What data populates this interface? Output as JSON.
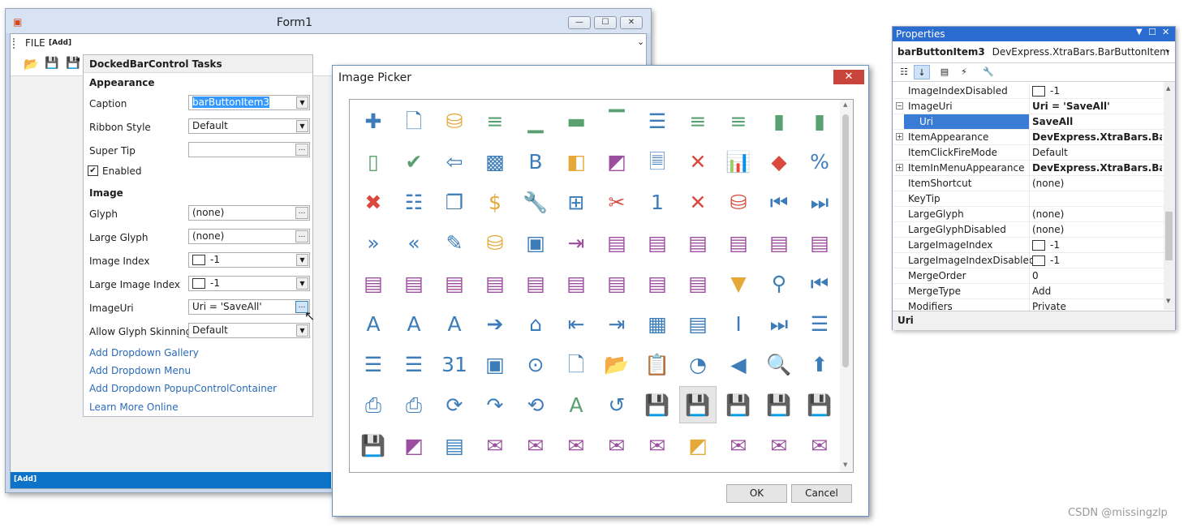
{
  "form1": {
    "title": "Form1",
    "menu": {
      "file_label": "FILE",
      "add_label": "[Add]"
    },
    "status_add": "[Add]",
    "controls": {
      "minimize": "—",
      "maximize": "☐",
      "close": "✕"
    }
  },
  "tasks": {
    "header": "DockedBarControl Tasks",
    "appearance": "Appearance",
    "caption_label": "Caption",
    "caption_value": "barButtonItem3",
    "ribbon_style_label": "Ribbon Style",
    "ribbon_style_value": "Default",
    "super_tip_label": "Super Tip",
    "super_tip_value": "",
    "enabled_label": "Enabled",
    "image": "Image",
    "glyph_label": "Glyph",
    "glyph_value": "(none)",
    "large_glyph_label": "Large Glyph",
    "large_glyph_value": "(none)",
    "image_index_label": "Image Index",
    "image_index_value": "-1",
    "large_image_index_label": "Large Image Index",
    "large_image_index_value": "-1",
    "image_uri_label": "ImageUri",
    "image_uri_value": "Uri = 'SaveAll'",
    "glyph_skinning_label": "Allow Glyph Skinning",
    "glyph_skinning_value": "Default",
    "links": [
      "Add Dropdown Gallery",
      "Add Dropdown Menu",
      "Add Dropdown PopupControlContainer",
      "Learn More Online"
    ]
  },
  "picker": {
    "title": "Image Picker",
    "close": "✕",
    "ok": "OK",
    "cancel": "Cancel",
    "icons": [
      [
        "add-icon",
        "new-document-icon",
        "add-database-icon",
        "align-center-icon",
        "align-bottom-icon",
        "align-middle-icon",
        "align-top-icon",
        "justify-icon",
        "align-left-icon",
        "align-right-icon",
        "column-left-icon",
        "column-right-icon"
      ],
      [
        "column-panel-icon",
        "check-icon",
        "back-icon",
        "image-frame-icon",
        "bold-icon",
        "bring-forward-icon",
        "send-backward-icon",
        "document-dot-icon",
        "close-icon",
        "bar-chart-icon",
        "eraser-icon",
        "clear-formatting-icon"
      ],
      [
        "delete-icon",
        "table-lines-icon",
        "copy-icon",
        "currency-icon",
        "customize-icon",
        "table-settings-icon",
        "cut-icon",
        "calendar-one-icon",
        "close-x-icon",
        "delete-database-icon",
        "first-icon",
        "last-icon"
      ],
      [
        "forward-icon",
        "rewind-icon",
        "edit-document-icon",
        "edit-database-icon",
        "image-edit-icon",
        "export-icon",
        "export-csv-icon",
        "export-doc-icon",
        "export-docx-icon",
        "export-epub-icon",
        "export-html-icon",
        "export-img-icon"
      ],
      [
        "export-mht-icon",
        "export-odt-icon",
        "export-pdf-icon",
        "export-rtf-icon",
        "export-txt-icon",
        "export-xls-icon",
        "export-xlsx-icon",
        "export-xml-icon",
        "export-xps-icon",
        "filter-icon",
        "find-icon",
        "first-page-icon"
      ],
      [
        "font-size-icon",
        "decrease-font-icon",
        "increase-font-icon",
        "go-icon",
        "home-icon",
        "indent-decrease-icon",
        "indent-increase-icon",
        "insert-image-icon",
        "insert-text-icon",
        "italic-icon",
        "last-page-icon",
        "list-bullets-icon"
      ],
      [
        "list-alpha-icon",
        "list-numbers-icon",
        "calendar-icon",
        "page-frame-icon",
        "navigation-icon",
        "blank-page-icon",
        "open-folder-icon",
        "paste-icon",
        "pie-chart-icon",
        "previous-icon",
        "preview-icon",
        "up-icon"
      ],
      [
        "print-icon",
        "print-help-icon",
        "refresh-icon",
        "redo-icon",
        "reload-icon",
        "spell-check-icon",
        "reset-icon",
        "save-icon",
        "save-all-icon",
        "save-close-icon",
        "save-to-icon",
        "save-as-icon"
      ],
      [
        "save-help-icon",
        "send-back-icon",
        "text-page-icon",
        "send-csv-icon",
        "send-img-icon",
        "send-mht-icon",
        "send-pdf-icon",
        "send-rtf-icon",
        "group-icon",
        "send-txt-icon",
        "send-xls-icon",
        "send-xlsx-icon"
      ]
    ],
    "glyphs": [
      [
        "✚",
        "🗋",
        "⛁",
        "≡",
        "▁",
        "▬",
        "▔",
        "☰",
        "≡",
        "≡",
        "▮",
        "▮"
      ],
      [
        "▯",
        "✔",
        "⇦",
        "▩",
        "B",
        "◧",
        "◩",
        "🗏",
        "✕",
        "📊",
        "◆",
        "%"
      ],
      [
        "✖",
        "☷",
        "❐",
        "$",
        "🔧",
        "⊞",
        "✂",
        "1",
        "✕",
        "⛁",
        "⏮",
        "⏭"
      ],
      [
        "»",
        "«",
        "✎",
        "⛁",
        "▣",
        "⇥",
        "▤",
        "▤",
        "▤",
        "▤",
        "▤",
        "▤"
      ],
      [
        "▤",
        "▤",
        "▤",
        "▤",
        "▤",
        "▤",
        "▤",
        "▤",
        "▤",
        "▼",
        "⚲",
        "⏮"
      ],
      [
        "A",
        "A",
        "A",
        "➔",
        "⌂",
        "⇤",
        "⇥",
        "▦",
        "▤",
        "I",
        "⏭",
        "☰"
      ],
      [
        "☰",
        "☰",
        "31",
        "▣",
        "⊙",
        "🗋",
        "📂",
        "📋",
        "◔",
        "◀",
        "🔍",
        "⬆"
      ],
      [
        "⎙",
        "⎙",
        "⟳",
        "↷",
        "⟲",
        "A",
        "↺",
        "💾",
        "💾",
        "💾",
        "💾",
        "💾"
      ],
      [
        "💾",
        "◩",
        "▤",
        "✉",
        "✉",
        "✉",
        "✉",
        "✉",
        "◩",
        "✉",
        "✉",
        "✉"
      ]
    ]
  },
  "props": {
    "title": "Properties",
    "object_name": "barButtonItem3",
    "object_type": "DevExpress.XtraBars.BarButtonItem",
    "rows": [
      {
        "name": "ImageIndexDisabled",
        "value": "-1",
        "swatch": true,
        "expander": ""
      },
      {
        "name": "ImageUri",
        "value": "Uri = 'SaveAll'",
        "bold": true,
        "expander": "−"
      },
      {
        "name": "Uri",
        "value": "SaveAll",
        "bold": true,
        "highlight": true,
        "expander": ""
      },
      {
        "name": "ItemAppearance",
        "value": "DevExpress.XtraBars.BarIter",
        "bold": true,
        "expander": "+"
      },
      {
        "name": "ItemClickFireMode",
        "value": "Default",
        "expander": ""
      },
      {
        "name": "ItemInMenuAppearance",
        "value": "DevExpress.XtraBars.BarIter",
        "bold": true,
        "expander": "+"
      },
      {
        "name": "ItemShortcut",
        "value": "(none)",
        "expander": ""
      },
      {
        "name": "KeyTip",
        "value": "",
        "expander": ""
      },
      {
        "name": "LargeGlyph",
        "value": "(none)",
        "expander": ""
      },
      {
        "name": "LargeGlyphDisabled",
        "value": "(none)",
        "expander": ""
      },
      {
        "name": "LargeImageIndex",
        "value": "-1",
        "swatch": true,
        "expander": ""
      },
      {
        "name": "LargeImageIndexDisabled",
        "value": "-1",
        "swatch": true,
        "expander": ""
      },
      {
        "name": "MergeOrder",
        "value": "0",
        "expander": ""
      },
      {
        "name": "MergeType",
        "value": "Add",
        "expander": ""
      },
      {
        "name": "Modifiers",
        "value": "Private",
        "expander": ""
      }
    ],
    "description": "Uri"
  },
  "watermark": "CSDN @missingzlp",
  "colors": {
    "accent": "#0b74c8",
    "icon_blue": "#3c7cb8",
    "icon_green": "#5aa070",
    "icon_red": "#d9493d",
    "icon_purple": "#9b4d9e",
    "icon_yellow": "#e5a93a"
  }
}
